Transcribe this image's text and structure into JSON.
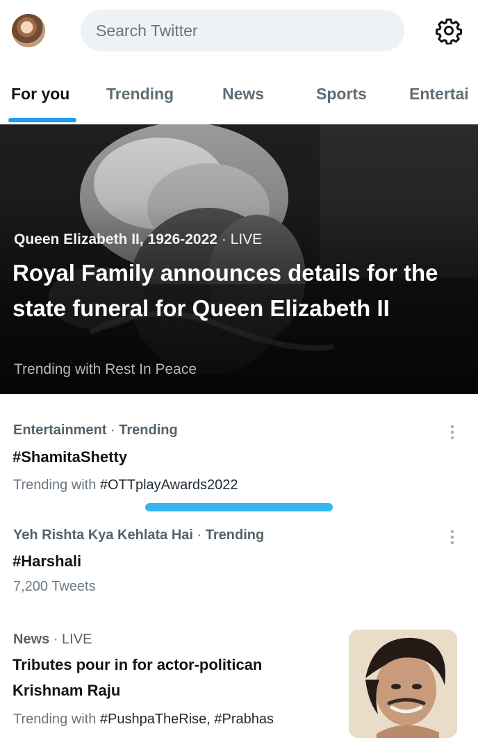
{
  "header": {
    "search_placeholder": "Search Twitter",
    "settings_icon": "gear-icon"
  },
  "tabs": [
    {
      "label": "For you",
      "active": true
    },
    {
      "label": "Trending",
      "active": false
    },
    {
      "label": "News",
      "active": false
    },
    {
      "label": "Sports",
      "active": false
    },
    {
      "label": "Entertai",
      "active": false
    }
  ],
  "hero": {
    "topic": "Queen Elizabeth II, 1926-2022",
    "separator": "·",
    "status": "LIVE",
    "title": "Royal Family announces details for the state funeral for Queen Elizabeth II",
    "subtitle": "Trending with Rest In Peace"
  },
  "trends": [
    {
      "category": "Entertainment",
      "separator": "·",
      "status": "Trending",
      "title": "#ShamitaShetty",
      "sub_prefix": "Trending with ",
      "sub_tags": "#OTTplayAwards2022"
    },
    {
      "category": "Yeh Rishta Kya Kehlata Hai",
      "separator": "·",
      "status": "Trending",
      "title": "#Harshali",
      "sub_count": "7,200 Tweets"
    },
    {
      "category": "News",
      "separator": "·",
      "status": "LIVE",
      "title_line1": "Tributes pour in for actor-politican",
      "title_line2": "Krishnam Raju",
      "sub_prefix": "Trending with ",
      "sub_tags": "#PushpaTheRise, #Prabhas"
    }
  ],
  "colors": {
    "accent": "#1d9bf0",
    "text": "#0f1419",
    "muted": "#5f6d76"
  }
}
